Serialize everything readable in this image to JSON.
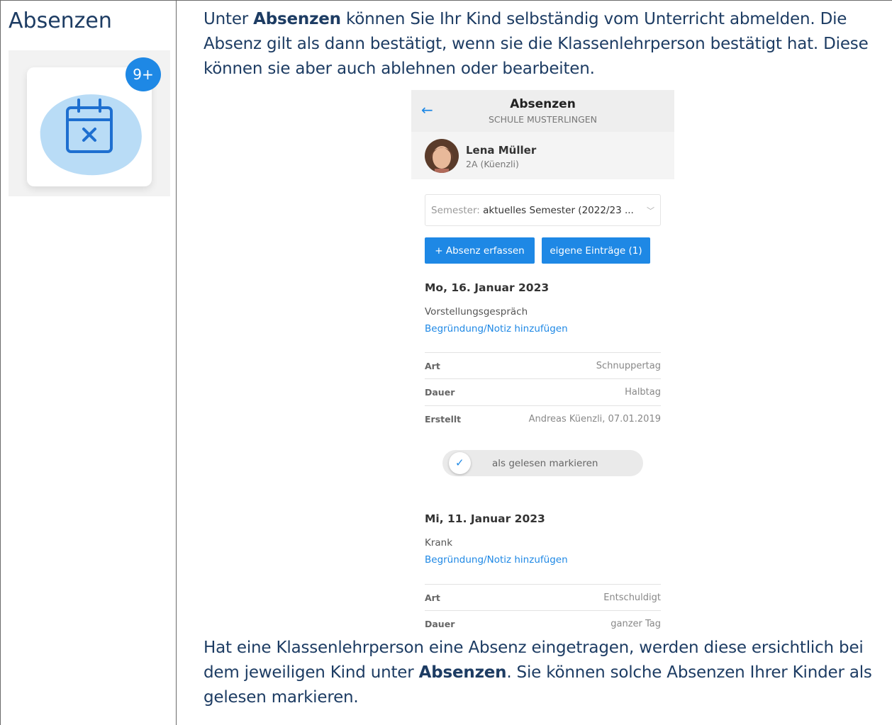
{
  "left": {
    "title": "Absenzen",
    "badge": "9+",
    "icon": "calendar-x-icon"
  },
  "intro": {
    "p1": "Unter ",
    "b1": "Absenzen",
    "p2": " können Sie Ihr Kind selbständig vom Unterricht abmelden. Die Absenz gilt als dann bestätigt, wenn sie die Klassenlehrperson bestätigt hat. Diese können sie aber auch ablehnen oder bearbeiten."
  },
  "outro": {
    "p1": "Hat eine Klassenlehrperson eine Absenz eingetragen, werden diese ersichtlich bei dem jeweiligen Kind unter ",
    "b1": "Absenzen",
    "p2": ". Sie können solche Absenzen Ihrer Kinder als gelesen markieren."
  },
  "phone": {
    "title": "Absenzen",
    "school": "SCHULE MUSTERLINGEN",
    "user": {
      "name": "Lena Müller",
      "class": "2A (Küenzli)"
    },
    "semester": {
      "label": "Semester:",
      "value": "aktuelles Semester (2022/23 ..."
    },
    "buttons": {
      "add": "+ Absenz erfassen",
      "own": "eigene Einträge (1)"
    },
    "entries": [
      {
        "date": "Mo, 16. Januar 2023",
        "reason": "Vorstellungsgespräch",
        "note_link": "Begründung/Notiz hinzufügen",
        "rows": [
          {
            "key": "Art",
            "value": "Schnuppertag"
          },
          {
            "key": "Dauer",
            "value": "Halbtag"
          },
          {
            "key": "Erstellt",
            "value": "Andreas Küenzli, 07.01.2019"
          }
        ],
        "mark_read": "als gelesen markieren"
      },
      {
        "date": "Mi, 11. Januar 2023",
        "reason": "Krank",
        "note_link": "Begründung/Notiz hinzufügen",
        "rows": [
          {
            "key": "Art",
            "value": "Entschuldigt"
          },
          {
            "key": "Dauer",
            "value": "ganzer Tag"
          }
        ]
      }
    ]
  },
  "colors": {
    "accent": "#1e88e5",
    "text": "#1d3c63"
  }
}
